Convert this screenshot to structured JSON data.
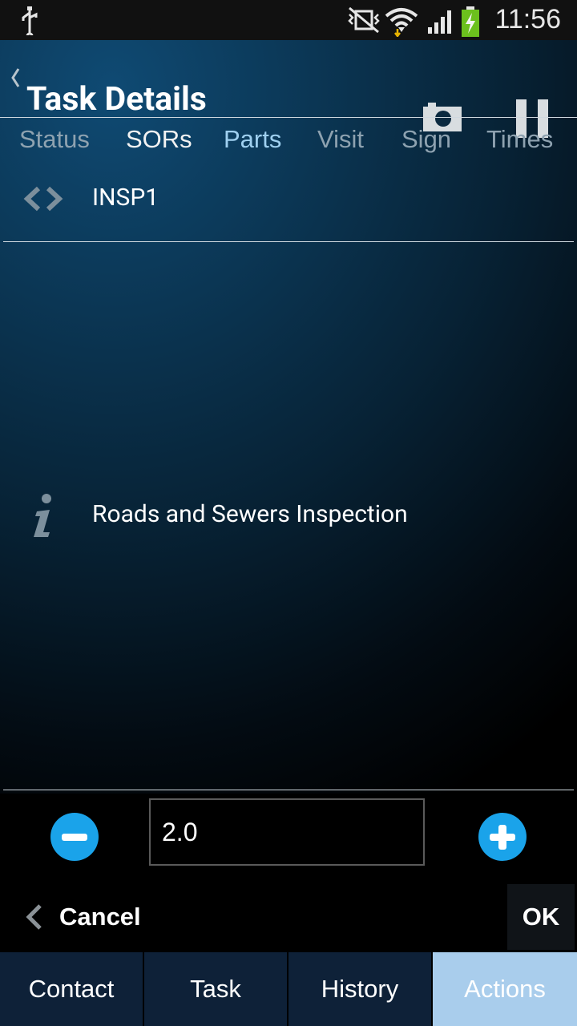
{
  "status_bar": {
    "time": "11:56"
  },
  "header": {
    "title": "Task Details"
  },
  "tabs": [
    {
      "label": "Status"
    },
    {
      "label": "SORs"
    },
    {
      "label": "Parts"
    },
    {
      "label": "Visit"
    },
    {
      "label": "Sign"
    },
    {
      "label": "Times"
    }
  ],
  "sor": {
    "code": "INSP1",
    "description": "Roads and Sewers Inspection"
  },
  "quantity": {
    "value": "2.0"
  },
  "actions": {
    "cancel_label": "Cancel",
    "ok_label": "OK"
  },
  "bottom_nav": [
    {
      "label": "Contact"
    },
    {
      "label": "Task"
    },
    {
      "label": "History"
    },
    {
      "label": "Actions"
    }
  ],
  "colors": {
    "accent": "#1aa3ea",
    "active_nav": "#a9cdec",
    "nav_bg": "#0e2138"
  }
}
